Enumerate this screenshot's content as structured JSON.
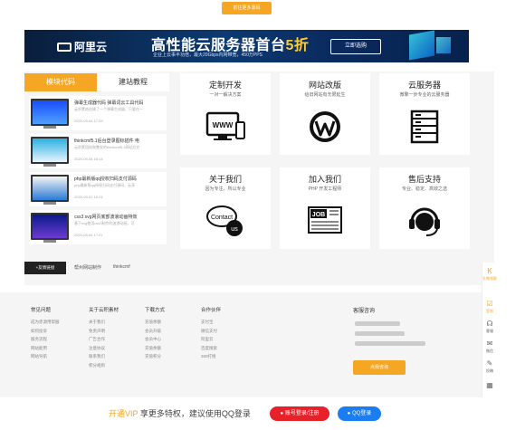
{
  "top_button": "前往更多源码",
  "banner": {
    "logo": "阿里云",
    "headline": "高性能云服务器首台",
    "headline_accent": "5折",
    "subtitle": "企业上云事半功倍，最大20Gbps内网带宽，450万PPS",
    "cta": "立即选购",
    "badge": "5W"
  },
  "tabs": {
    "active": "模块代码",
    "inactive": "建站教程"
  },
  "articles": [
    {
      "title": "弹幕生成器代码 弹幕词云工具代码",
      "desc": "云积累结创建了一个弹幕生成器，只要在一",
      "date": "2020-09-08 17:09"
    },
    {
      "title": "thinkcmf5.1后台登录图标插件 电",
      "desc": "云积累团结和整发的thinkcmf5.1网站后台",
      "date": "2020-09-08 18:14"
    },
    {
      "title": "php最新版qq授权扫码支付源码",
      "desc": "php最新版qq授权扫码支付源码，云享",
      "date": "2020-09-02 16:24"
    },
    {
      "title": "css3 svg网页底部波浪动画特效",
      "desc": "基于svg使用css3制作的波浪动画，可",
      "date": "2020-08-06 17:21"
    }
  ],
  "cards": [
    {
      "title": "定制开发",
      "sub": "一对一解决方案",
      "icon": "www-devices-icon"
    },
    {
      "title": "网站改版",
      "sub": "给旧网站有无限延生",
      "icon": "wordpress-icon"
    },
    {
      "title": "云服务器",
      "sub": "微擎一步专业的云服务器",
      "icon": "server-icon"
    },
    {
      "title": "关于我们",
      "sub": "因为专注，所以专业",
      "icon": "contact-bubble-icon"
    },
    {
      "title": "加入我们",
      "sub": "PHP 开发工程师",
      "icon": "job-newspaper-icon"
    },
    {
      "title": "售后支持",
      "sub": "专业、稳定、高效之选",
      "icon": "headset-icon"
    }
  ],
  "card_icon_text": {
    "www": "WWW",
    "contact": "Contact",
    "us": "us",
    "job": "JOB"
  },
  "friend_links": {
    "label": "+友情链接",
    "links": [
      "帮州网站制作",
      "thinkcmf"
    ]
  },
  "footer_cols": [
    {
      "title": "常见问题",
      "items": [
        "成为赤源用帮服",
        "如何投诉",
        "服务流程",
        "网站能用",
        "网站导航"
      ]
    },
    {
      "title": "关于云积素材",
      "items": [
        "关于我们",
        "免责声明",
        "广告合作",
        "注意协议",
        "联系我们",
        "积分规则"
      ]
    },
    {
      "title": "下载方式",
      "items": [
        "充值余额",
        "会员升级",
        "会员中心",
        "充值余额",
        "充值积分"
      ]
    },
    {
      "title": "合作伙伴",
      "items": [
        "支付宝",
        "微信支付",
        "阿里云",
        "百度搜索",
        "360打搜"
      ]
    }
  ],
  "service": {
    "title": "客服咨询",
    "button": "点我咨询"
  },
  "side_items": [
    "在线客服",
    "签到",
    "客服",
    "微信",
    "反馈",
    "二维码"
  ],
  "side_labels": [
    "礼物领取",
    "签到",
    "客服",
    "微信",
    "投稿",
    ""
  ],
  "bottom": {
    "prefix": "开通VIP",
    "message": " 享更多特权，建议使用QQ登录",
    "btn1": "账号登录/注册",
    "btn2": "QQ登录"
  }
}
